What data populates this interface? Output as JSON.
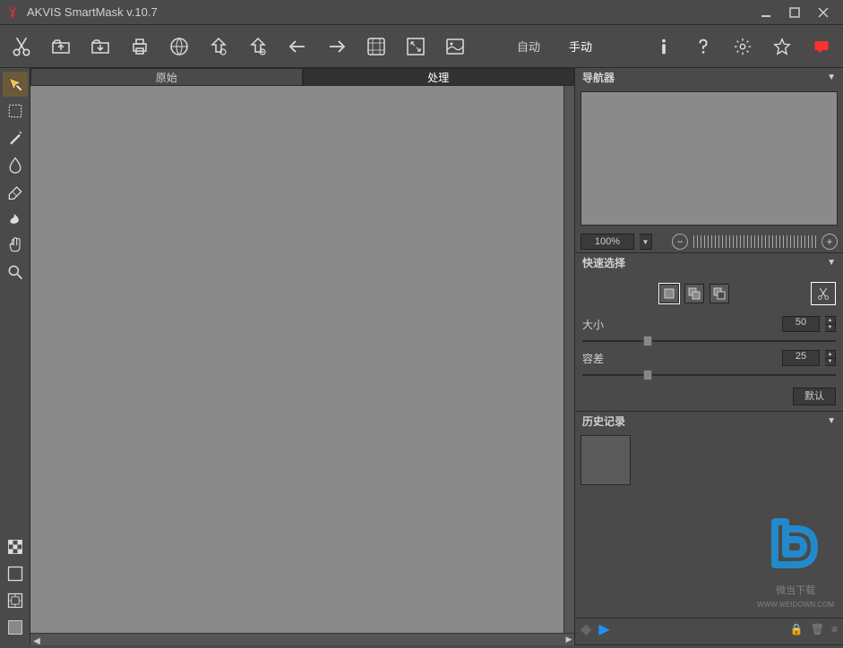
{
  "title": "AKVIS SmartMask v.10.7",
  "toolbar": {
    "mode_auto": "自动",
    "mode_manual": "手动"
  },
  "tabs": {
    "original": "原始",
    "process": "处理"
  },
  "panels": {
    "navigator": "导航器",
    "quick_select": "快速选择",
    "history": "历史记录"
  },
  "nav": {
    "zoom": "100%"
  },
  "quick_select": {
    "size_label": "大小",
    "size_value": "50",
    "tolerance_label": "容差",
    "tolerance_value": "25",
    "default_btn": "默认"
  },
  "watermark": {
    "text": "微当下载",
    "sub": "WWW.WEIDOWN.COM"
  }
}
